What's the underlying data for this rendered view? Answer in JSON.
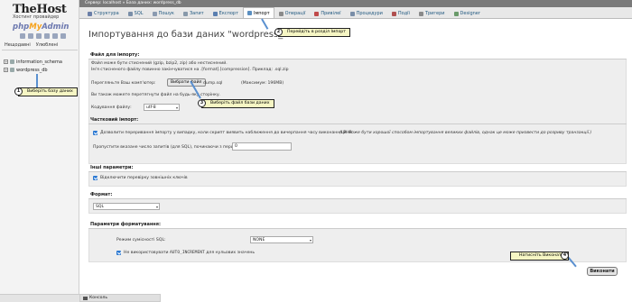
{
  "browser": {
    "breadcrumb": "Сервер: localhost  »  База даних: wordpress_db"
  },
  "sidebar": {
    "brand": "TheHost",
    "brand_sub": "Хостинг провайдер",
    "pma_php": "php",
    "pma_my": "My",
    "pma_admin": "Admin",
    "tabs": [
      "Нещодавні",
      "Улюблені"
    ],
    "databases": [
      {
        "label": "information_schema"
      },
      {
        "label": "wordpress_db"
      }
    ]
  },
  "tabs": [
    {
      "label": "Структура",
      "icon": "structure-icon",
      "color": "#6b7fa8"
    },
    {
      "label": "SQL",
      "icon": "sql-icon",
      "color": "#7a8ea8"
    },
    {
      "label": "Пошук",
      "icon": "search-icon",
      "color": "#8a9ab0"
    },
    {
      "label": "Запит",
      "icon": "query-icon",
      "color": "#8899aa"
    },
    {
      "label": "Експорт",
      "icon": "export-icon",
      "color": "#5b7fb0"
    },
    {
      "label": "Імпорт",
      "icon": "import-icon",
      "color": "#5b8fc0",
      "active": true
    },
    {
      "label": "Операції",
      "icon": "wrench-icon",
      "color": "#8a8a8a"
    },
    {
      "label": "Привілеї",
      "icon": "privileges-icon",
      "color": "#c04a4a"
    },
    {
      "label": "Процедури",
      "icon": "routines-icon",
      "color": "#7a8ea8"
    },
    {
      "label": "Події",
      "icon": "events-icon",
      "color": "#b05050"
    },
    {
      "label": "Тригери",
      "icon": "triggers-icon",
      "color": "#8a8a8a"
    },
    {
      "label": "Designer",
      "icon": "designer-icon",
      "color": "#6a9a6a"
    }
  ],
  "main": {
    "title": "Імпортування до бази даних \"wordpress_db\"",
    "file_section": {
      "header": "Файл для імпорту:",
      "note1": "Файл може бути стиснений (gzip, bzip2, zip) або нестиснений.",
      "note2": "Ім'я стисненого файлу повинно закінчуватися на .[format].[compression]. Приклад: .sql.zip",
      "browse_label": "Перегляньте Ваш комп'ютер:",
      "choose_button": "Вибрати файл",
      "chosen_file": "dump.sql",
      "max_size": "(Максимум: 196MB)",
      "drag_hint": "Ви також можете перетягнути файл на будь-яку сторінку.",
      "charset_label": "Кодування файлу:",
      "charset_value": "utf-8"
    },
    "partial_section": {
      "header": "Частковий імпорт:",
      "allow_interrupt": "Дозволити переривання імпорту у випадку, коли скрипт виявить наближення до вичерпання часу виконання PHP.",
      "allow_interrupt_note": "(Це може бути хорошої способом імпортування великих файлів, однак це може призвести до розриву транзакції.)",
      "skip_label": "Пропустити вказане число запитів (для SQL), починаючи з першого:",
      "skip_value": "0"
    },
    "other_section": {
      "header": "Інші параметри:",
      "fk_label": "Відключити перевірку зовнішніх ключів"
    },
    "format_section": {
      "header": "Формат:",
      "value": "SQL"
    },
    "format_options_section": {
      "header": "Параметри форматування:",
      "compat_label": "Режим сумісності SQL:",
      "compat_value": "NONE",
      "auto_inc_label_pre": "Не використовувати",
      "auto_inc_code": "AUTO_INCREMENT",
      "auto_inc_label_post": "для нульових значень"
    },
    "go_button": "Виконати"
  },
  "console": {
    "label": "Консоль"
  },
  "callouts": {
    "c1": {
      "num": "1",
      "text": "Виберіть базу даних"
    },
    "c2": {
      "num": "2",
      "text": "Перейдіть в розділ Імпорт"
    },
    "c3": {
      "num": "3",
      "text": "Виберіть файл бази даних"
    },
    "c4": {
      "num": "4",
      "text": "Натисніть Виконати"
    }
  }
}
